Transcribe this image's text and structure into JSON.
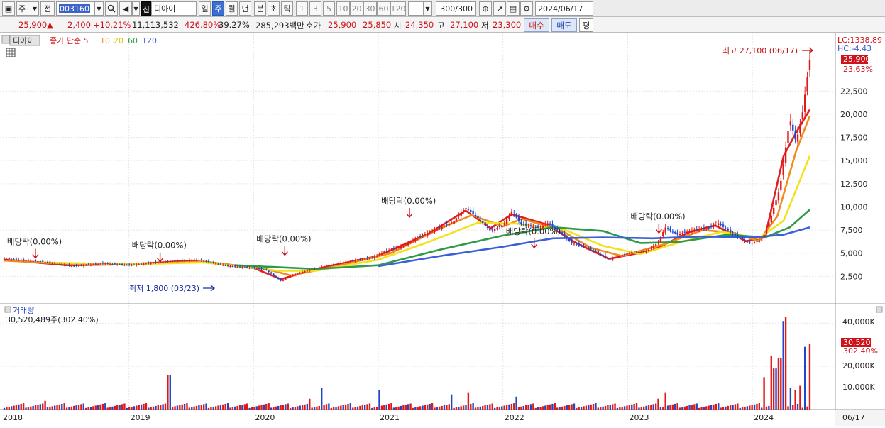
{
  "toolbar": {
    "market": "주",
    "prev_label": "전",
    "code": "003160",
    "badge": "신",
    "stock_name": "디아이",
    "periods": [
      "일",
      "주",
      "월",
      "년",
      "분",
      "초",
      "틱"
    ],
    "active_period": "주",
    "intervals": [
      "1",
      "3",
      "5",
      "10",
      "20",
      "30",
      "60",
      "120"
    ],
    "count": "300/300",
    "date": "2024/06/17"
  },
  "quote": {
    "price": "25,900",
    "arrow": "▲",
    "change": "2,400",
    "change_pct": "+10.21%",
    "volume": "11,113,532",
    "vol_ratio": "426.80%",
    "turnover": "39.27%",
    "amount": "285,293백만",
    "hoga_label": "호가",
    "ask": "25,900",
    "bid": "25,850",
    "open_label": "시",
    "open": "24,350",
    "high_label": "고",
    "high": "27,100",
    "low_label": "저",
    "low": "23,300",
    "buy_label": "매수",
    "sell_label": "매도",
    "eval_label": "평"
  },
  "chart_data": {
    "type": "candlestick",
    "title": "디아이",
    "legend": [
      "종가 단순 5",
      "10",
      "20",
      "60",
      "120"
    ],
    "ma_colors": [
      "#e02020",
      "#f08c1e",
      "#f2e21c",
      "#2e9a48",
      "#3a5fd8"
    ],
    "y_ticks": [
      2500,
      5000,
      7500,
      10000,
      12500,
      15000,
      17500,
      20000,
      22500
    ],
    "ylim": [
      0,
      27500
    ],
    "x_labels": [
      "2018",
      "2019",
      "2020",
      "2021",
      "2022",
      "2023",
      "2024",
      "06/17"
    ],
    "price_path": [
      {
        "x": 2018.0,
        "y": 4400
      },
      {
        "x": 2018.3,
        "y": 4100
      },
      {
        "x": 2018.55,
        "y": 3600
      },
      {
        "x": 2018.8,
        "y": 3900
      },
      {
        "x": 2019.0,
        "y": 3700
      },
      {
        "x": 2019.3,
        "y": 4100
      },
      {
        "x": 2019.55,
        "y": 4300
      },
      {
        "x": 2019.8,
        "y": 3600
      },
      {
        "x": 2020.0,
        "y": 3400
      },
      {
        "x": 2020.1,
        "y": 3200
      },
      {
        "x": 2020.22,
        "y": 2000
      },
      {
        "x": 2020.3,
        "y": 2600
      },
      {
        "x": 2020.45,
        "y": 3200
      },
      {
        "x": 2020.6,
        "y": 3700
      },
      {
        "x": 2020.8,
        "y": 4200
      },
      {
        "x": 2020.95,
        "y": 4500
      },
      {
        "x": 2021.05,
        "y": 5200
      },
      {
        "x": 2021.2,
        "y": 5800
      },
      {
        "x": 2021.35,
        "y": 6900
      },
      {
        "x": 2021.5,
        "y": 7800
      },
      {
        "x": 2021.6,
        "y": 8400
      },
      {
        "x": 2021.7,
        "y": 9900
      },
      {
        "x": 2021.8,
        "y": 8800
      },
      {
        "x": 2021.9,
        "y": 7400
      },
      {
        "x": 2022.0,
        "y": 8000
      },
      {
        "x": 2022.07,
        "y": 9500
      },
      {
        "x": 2022.15,
        "y": 8100
      },
      {
        "x": 2022.3,
        "y": 7700
      },
      {
        "x": 2022.35,
        "y": 8300
      },
      {
        "x": 2022.45,
        "y": 7400
      },
      {
        "x": 2022.55,
        "y": 6100
      },
      {
        "x": 2022.7,
        "y": 5500
      },
      {
        "x": 2022.85,
        "y": 4300
      },
      {
        "x": 2023.0,
        "y": 5000
      },
      {
        "x": 2023.15,
        "y": 5200
      },
      {
        "x": 2023.25,
        "y": 6200
      },
      {
        "x": 2023.3,
        "y": 7800
      },
      {
        "x": 2023.4,
        "y": 7000
      },
      {
        "x": 2023.55,
        "y": 7600
      },
      {
        "x": 2023.65,
        "y": 7700
      },
      {
        "x": 2023.72,
        "y": 8300
      },
      {
        "x": 2023.85,
        "y": 7000
      },
      {
        "x": 2023.95,
        "y": 6200
      },
      {
        "x": 2024.0,
        "y": 6100
      },
      {
        "x": 2024.08,
        "y": 6500
      },
      {
        "x": 2024.15,
        "y": 9000
      },
      {
        "x": 2024.22,
        "y": 12000
      },
      {
        "x": 2024.3,
        "y": 19500
      },
      {
        "x": 2024.35,
        "y": 17000
      },
      {
        "x": 2024.4,
        "y": 20000
      },
      {
        "x": 2024.46,
        "y": 25900
      }
    ],
    "moving_averages": [
      {
        "name": "5",
        "color": "#e02020",
        "points": [
          {
            "x": 2018.0,
            "y": 4300
          },
          {
            "x": 2018.5,
            "y": 3700
          },
          {
            "x": 2019.0,
            "y": 3800
          },
          {
            "x": 2019.5,
            "y": 4200
          },
          {
            "x": 2020.0,
            "y": 3400
          },
          {
            "x": 2020.22,
            "y": 2200
          },
          {
            "x": 2020.5,
            "y": 3300
          },
          {
            "x": 2021.0,
            "y": 4700
          },
          {
            "x": 2021.4,
            "y": 7100
          },
          {
            "x": 2021.7,
            "y": 9600
          },
          {
            "x": 2021.9,
            "y": 7700
          },
          {
            "x": 2022.07,
            "y": 9200
          },
          {
            "x": 2022.35,
            "y": 8100
          },
          {
            "x": 2022.6,
            "y": 6000
          },
          {
            "x": 2022.85,
            "y": 4400
          },
          {
            "x": 2023.2,
            "y": 5300
          },
          {
            "x": 2023.5,
            "y": 7300
          },
          {
            "x": 2023.7,
            "y": 8000
          },
          {
            "x": 2023.95,
            "y": 6300
          },
          {
            "x": 2024.1,
            "y": 6700
          },
          {
            "x": 2024.25,
            "y": 15500
          },
          {
            "x": 2024.35,
            "y": 18000
          },
          {
            "x": 2024.46,
            "y": 20500
          }
        ]
      },
      {
        "name": "10",
        "color": "#f08c1e",
        "points": [
          {
            "x": 2018.0,
            "y": 4200
          },
          {
            "x": 2018.6,
            "y": 3800
          },
          {
            "x": 2019.2,
            "y": 3900
          },
          {
            "x": 2019.6,
            "y": 4100
          },
          {
            "x": 2020.1,
            "y": 3300
          },
          {
            "x": 2020.3,
            "y": 2600
          },
          {
            "x": 2020.7,
            "y": 3700
          },
          {
            "x": 2021.1,
            "y": 5000
          },
          {
            "x": 2021.5,
            "y": 7700
          },
          {
            "x": 2021.75,
            "y": 9100
          },
          {
            "x": 2022.0,
            "y": 7900
          },
          {
            "x": 2022.15,
            "y": 8700
          },
          {
            "x": 2022.45,
            "y": 7600
          },
          {
            "x": 2022.7,
            "y": 5600
          },
          {
            "x": 2022.95,
            "y": 4700
          },
          {
            "x": 2023.3,
            "y": 6000
          },
          {
            "x": 2023.6,
            "y": 7500
          },
          {
            "x": 2023.85,
            "y": 7200
          },
          {
            "x": 2024.05,
            "y": 6300
          },
          {
            "x": 2024.2,
            "y": 9000
          },
          {
            "x": 2024.35,
            "y": 16000
          },
          {
            "x": 2024.46,
            "y": 19800
          }
        ]
      },
      {
        "name": "20",
        "color": "#f2e21c",
        "points": [
          {
            "x": 2018.3,
            "y": 4000
          },
          {
            "x": 2019.0,
            "y": 3800
          },
          {
            "x": 2019.6,
            "y": 4000
          },
          {
            "x": 2020.2,
            "y": 3100
          },
          {
            "x": 2020.5,
            "y": 3100
          },
          {
            "x": 2021.0,
            "y": 4300
          },
          {
            "x": 2021.4,
            "y": 6200
          },
          {
            "x": 2021.8,
            "y": 8300
          },
          {
            "x": 2022.1,
            "y": 8200
          },
          {
            "x": 2022.5,
            "y": 7500
          },
          {
            "x": 2022.8,
            "y": 5800
          },
          {
            "x": 2023.1,
            "y": 4900
          },
          {
            "x": 2023.4,
            "y": 6100
          },
          {
            "x": 2023.75,
            "y": 7300
          },
          {
            "x": 2024.05,
            "y": 6600
          },
          {
            "x": 2024.25,
            "y": 8500
          },
          {
            "x": 2024.46,
            "y": 15500
          }
        ]
      },
      {
        "name": "60",
        "color": "#2e9a48",
        "points": [
          {
            "x": 2019.85,
            "y": 3700
          },
          {
            "x": 2020.5,
            "y": 3300
          },
          {
            "x": 2021.0,
            "y": 3700
          },
          {
            "x": 2021.5,
            "y": 5400
          },
          {
            "x": 2022.0,
            "y": 6900
          },
          {
            "x": 2022.4,
            "y": 7800
          },
          {
            "x": 2022.8,
            "y": 7400
          },
          {
            "x": 2023.1,
            "y": 6100
          },
          {
            "x": 2023.4,
            "y": 6200
          },
          {
            "x": 2023.8,
            "y": 7000
          },
          {
            "x": 2024.1,
            "y": 6700
          },
          {
            "x": 2024.3,
            "y": 7800
          },
          {
            "x": 2024.46,
            "y": 9700
          }
        ]
      },
      {
        "name": "120",
        "color": "#3a5fd8",
        "points": [
          {
            "x": 2021.0,
            "y": 3600
          },
          {
            "x": 2021.5,
            "y": 4700
          },
          {
            "x": 2022.0,
            "y": 5700
          },
          {
            "x": 2022.4,
            "y": 6600
          },
          {
            "x": 2022.8,
            "y": 6700
          },
          {
            "x": 2023.2,
            "y": 6600
          },
          {
            "x": 2023.6,
            "y": 6800
          },
          {
            "x": 2024.0,
            "y": 6700
          },
          {
            "x": 2024.25,
            "y": 7000
          },
          {
            "x": 2024.46,
            "y": 7800
          }
        ]
      }
    ],
    "annotations": [
      {
        "text": "배당락(0.00%)",
        "x": 2018.25,
        "price": 4100
      },
      {
        "text": "배당락(0.00%)",
        "x": 2019.25,
        "price": 3700
      },
      {
        "text": "배당락(0.00%)",
        "x": 2020.25,
        "price": 4400
      },
      {
        "text": "배당락(0.00%)",
        "x": 2021.25,
        "price": 8500
      },
      {
        "text": "배당락(0.00%)",
        "x": 2022.25,
        "price": 5200
      },
      {
        "text": "배당락(0.00%)",
        "x": 2023.25,
        "price": 6800
      }
    ],
    "max_label": "최고 27,100 (06/17)",
    "min_label": "최저 1,800 (03/23)",
    "right_labels": {
      "lc": "LC:1338.89",
      "hc": "HC:-4.43",
      "price": "25,900",
      "pct": "23.63%"
    },
    "volume": {
      "title": "거래량",
      "value_label": "30,520,489주(302.40%)",
      "y_ticks": [
        "10,000K",
        "20,000K",
        "40,000K"
      ],
      "last_label": "30,520K",
      "last_pct": "302.40%",
      "ylim": [
        0,
        45000
      ],
      "spikes": [
        {
          "x": 2018.33,
          "v": 4000
        },
        {
          "x": 2019.32,
          "v": 16000
        },
        {
          "x": 2020.45,
          "v": 5000
        },
        {
          "x": 2020.55,
          "v": 10000
        },
        {
          "x": 2021.0,
          "v": 9000
        },
        {
          "x": 2021.58,
          "v": 7000
        },
        {
          "x": 2021.73,
          "v": 8000
        },
        {
          "x": 2022.1,
          "v": 6000
        },
        {
          "x": 2023.25,
          "v": 5000
        },
        {
          "x": 2023.3,
          "v": 8000
        },
        {
          "x": 2024.1,
          "v": 15000
        },
        {
          "x": 2024.15,
          "v": 25000
        },
        {
          "x": 2024.18,
          "v": 19000
        },
        {
          "x": 2024.22,
          "v": 24000
        },
        {
          "x": 2024.25,
          "v": 41000
        },
        {
          "x": 2024.27,
          "v": 43000
        },
        {
          "x": 2024.3,
          "v": 10000
        },
        {
          "x": 2024.34,
          "v": 9000
        },
        {
          "x": 2024.38,
          "v": 11000
        },
        {
          "x": 2024.42,
          "v": 29000
        },
        {
          "x": 2024.46,
          "v": 30520
        }
      ]
    }
  }
}
